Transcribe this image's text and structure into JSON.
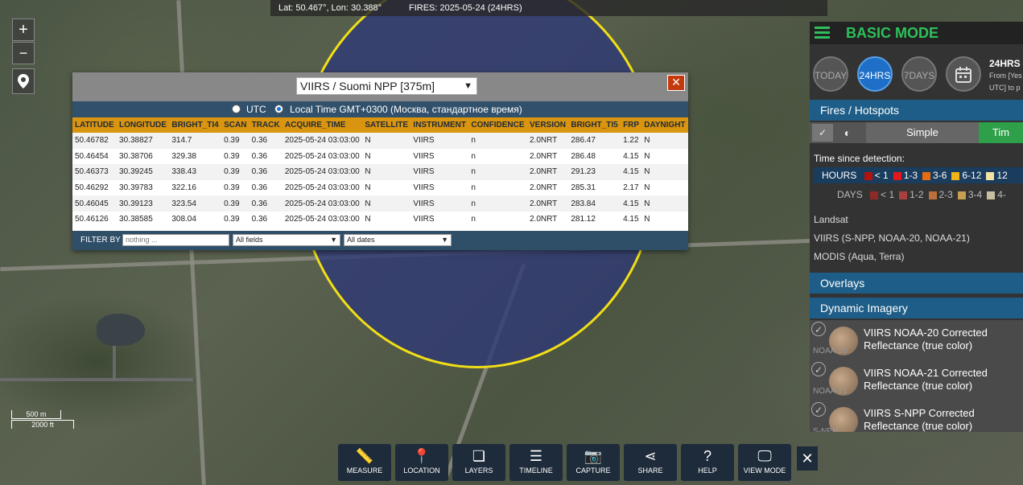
{
  "topbar": {
    "coords": "Lat: 50.467°, Lon: 30.388°",
    "fires": "FIRES: 2025-05-24 (24HRS)"
  },
  "map_controls": {
    "zoom_in": "+",
    "zoom_out": "−"
  },
  "popup": {
    "sensor": "VIIRS / Suomi NPP [375m]",
    "close": "✕",
    "utc_label": "UTC",
    "local_label": "Local Time GMT+0300 (Москва, стандартное время)",
    "columns": [
      "LATITUDE",
      "LONGITUDE",
      "BRIGHT_TI4",
      "SCAN",
      "TRACK",
      "ACQUIRE_TIME",
      "SATELLITE",
      "INSTRUMENT",
      "CONFIDENCE",
      "VERSION",
      "BRIGHT_TI5",
      "FRP",
      "DAYNIGHT"
    ],
    "rows": [
      [
        "50.46782",
        "30.38827",
        "314.7",
        "0.39",
        "0.36",
        "2025-05-24 03:03:00",
        "N",
        "VIIRS",
        "n",
        "2.0NRT",
        "286.47",
        "1.22",
        "N"
      ],
      [
        "50.46454",
        "30.38706",
        "329.38",
        "0.39",
        "0.36",
        "2025-05-24 03:03:00",
        "N",
        "VIIRS",
        "n",
        "2.0NRT",
        "286.48",
        "4.15",
        "N"
      ],
      [
        "50.46373",
        "30.39245",
        "338.43",
        "0.39",
        "0.36",
        "2025-05-24 03:03:00",
        "N",
        "VIIRS",
        "n",
        "2.0NRT",
        "291.23",
        "4.15",
        "N"
      ],
      [
        "50.46292",
        "30.39783",
        "322.16",
        "0.39",
        "0.36",
        "2025-05-24 03:03:00",
        "N",
        "VIIRS",
        "n",
        "2.0NRT",
        "285.31",
        "2.17",
        "N"
      ],
      [
        "50.46045",
        "30.39123",
        "323.54",
        "0.39",
        "0.36",
        "2025-05-24 03:03:00",
        "N",
        "VIIRS",
        "n",
        "2.0NRT",
        "283.84",
        "4.15",
        "N"
      ],
      [
        "50.46126",
        "30.38585",
        "308.04",
        "0.39",
        "0.36",
        "2025-05-24 03:03:00",
        "N",
        "VIIRS",
        "n",
        "2.0NRT",
        "281.12",
        "4.15",
        "N"
      ]
    ],
    "filter_by": "FILTER BY",
    "filter_placeholder": "nothing ...",
    "fields_select": "All fields",
    "dates_select": "All dates"
  },
  "side": {
    "mode": "BASIC MODE",
    "time_buttons": [
      "TODAY",
      "24HRS",
      "7DAYS"
    ],
    "range_title": "24HRS",
    "range_line1": "From [Yes",
    "range_line2": "UTC] to p",
    "fires_section": "Fires / Hotspots",
    "simple_label": "Simple",
    "time_label": "Tim",
    "since_detection": "Time since detection:",
    "hours_label": "HOURS",
    "hours": [
      "< 1",
      "1-3",
      "3-6",
      "6-12",
      "12"
    ],
    "hours_colors": [
      "#b3120e",
      "#e6161e",
      "#e86b12",
      "#f0b31a",
      "#f3e3a5"
    ],
    "days_label": "DAYS",
    "days": [
      "< 1",
      "1-2",
      "2-3",
      "3-4",
      "4-"
    ],
    "days_colors": [
      "#8e2a25",
      "#a84040",
      "#b9703a",
      "#c4a050",
      "#c9bda0"
    ],
    "landsat": "Landsat",
    "viirs": "VIIRS (S-NPP, NOAA-20, NOAA-21)",
    "modis": "MODIS (Aqua, Terra)",
    "overlays": "Overlays",
    "dynamic": "Dynamic Imagery",
    "imagery": [
      {
        "sub": "NOAA-20",
        "title": "VIIRS NOAA-20 Corrected Reflectance (true color)"
      },
      {
        "sub": "NOAA-21",
        "title": "VIIRS NOAA-21 Corrected Reflectance (true color)"
      },
      {
        "sub": "S-NPP",
        "title": "VIIRS S-NPP Corrected Reflectance (true color)"
      }
    ]
  },
  "toolbar": [
    {
      "label": "MEASURE",
      "icon": "ruler-icon",
      "glyph": "📏"
    },
    {
      "label": "LOCATION",
      "icon": "location-pin-icon",
      "glyph": "📍"
    },
    {
      "label": "LAYERS",
      "icon": "layers-icon",
      "glyph": "❏"
    },
    {
      "label": "TIMELINE",
      "icon": "timeline-sliders-icon",
      "glyph": "☰"
    },
    {
      "label": "CAPTURE",
      "icon": "camera-icon",
      "glyph": "📷"
    },
    {
      "label": "SHARE",
      "icon": "share-icon",
      "glyph": "⋖"
    },
    {
      "label": "HELP",
      "icon": "help-icon",
      "glyph": "?"
    },
    {
      "label": "VIEW MODE",
      "icon": "monitor-icon",
      "glyph": "🖵"
    }
  ],
  "toolbar_close": "✕",
  "scale": {
    "metric": "500 m",
    "imperial": "2000 ft"
  }
}
